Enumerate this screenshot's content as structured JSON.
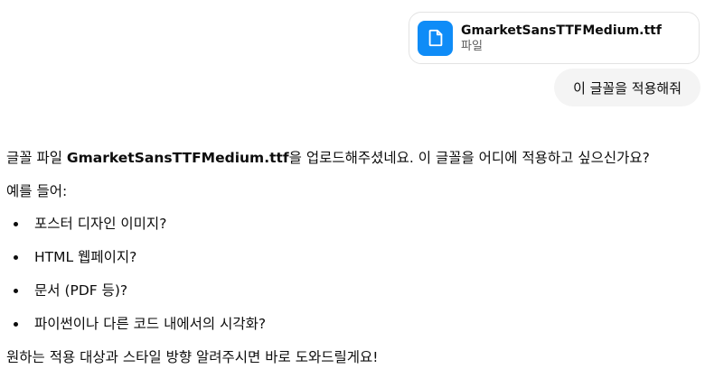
{
  "attachment": {
    "icon": "file-icon",
    "color": "#0f8cf7",
    "file_name": "GmarketSansTTFMedium.ttf",
    "file_type": "파일"
  },
  "user_message": {
    "text": "이 글꼴을 적용해줘"
  },
  "assistant_message": {
    "intro_prefix": "글꼴 파일 ",
    "intro_bold": "GmarketSansTTFMedium.ttf",
    "intro_suffix": "을 업로드해주셨네요. 이 글꼴을 어디에 적용하고 싶으신가요?",
    "example_label": "예를 들어:",
    "examples": [
      "포스터 디자인 이미지?",
      "HTML 웹페이지?",
      "문서 (PDF 등)?",
      "파이썬이나 다른 코드 내에서의 시각화?"
    ],
    "closing": "원하는 적용 대상과 스타일 방향 알려주시면 바로 도와드릴게요!"
  }
}
